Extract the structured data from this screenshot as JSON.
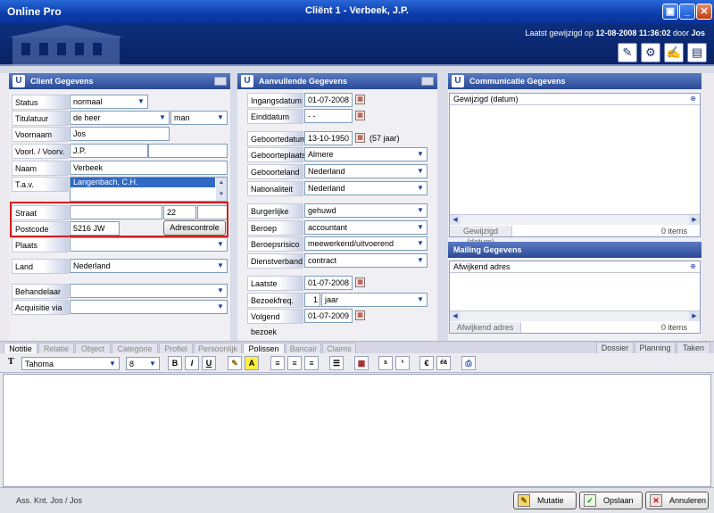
{
  "window": {
    "app_title": "Online Pro",
    "title": "Cliënt 1  -  Verbeek, J.P."
  },
  "header": {
    "last_modified_prefix": "Laatst gewijzigd op ",
    "last_modified_date": "12-08-2008 11:36:02",
    "by_label": " door ",
    "user": "Jos"
  },
  "client": {
    "title": "Client Gegevens",
    "status_label": "Status",
    "status": "normaal",
    "titulatuur_label": "Titulatuur",
    "titulatuur": "de heer",
    "gender": "man",
    "voornaam_label": "Voornaam",
    "voornaam": "Jos",
    "voorl_label": "Voorl. / Voorv.",
    "voorletters": "J.P.",
    "naam_label": "Naam",
    "naam": "Verbeek",
    "tav_label": "T.a.v.",
    "tav": "Langenbach, C.H.",
    "straat_label": "Straat",
    "huisnummer": "22",
    "postcode_label": "Postcode",
    "postcode": "5216 JW",
    "adrescontrole": "Adrescontrole",
    "plaats_label": "Plaats",
    "land_label": "Land",
    "land": "Nederland",
    "behandelaar_label": "Behandelaar",
    "acquisitie_label": "Acquisitie via"
  },
  "extra": {
    "title": "Aanvullende Gegevens",
    "ingangsdatum_label": "Ingangsdatum",
    "ingangsdatum": "01-07-2008",
    "einddatum_label": "Einddatum",
    "einddatum": " -  -",
    "geboortedatum_label": "Geboortedatum",
    "geboortedatum": "13-10-1950",
    "leeftijd": "(57 jaar)",
    "geboorteplaats_label": "Geboorteplaats",
    "geboorteplaats": "Almere",
    "geboorteland_label": "Geboorteland",
    "geboorteland": "Nederland",
    "nationaliteit_label": "Nationaliteit",
    "nationaliteit": "Nederland",
    "burgerlijke_label": "Burgerlijke staat",
    "burgerlijke": "gehuwd",
    "beroep_label": "Beroep",
    "beroep": "accountant",
    "beroepsrisico_label": "Beroepsrisico",
    "beroepsrisico": "meewerkend/uitvoerend",
    "dienstverband_label": "Dienstverband",
    "dienstverband": "contract",
    "laatste_label": "Laatste bezoek",
    "laatste": "01-07-2008",
    "bezoekfreq_label": "Bezoekfreq.",
    "bezoekfreq_num": "1",
    "bezoekfreq_unit": "jaar",
    "volgend_label": "Volgend bezoek",
    "volgend": "01-07-2009"
  },
  "comm": {
    "title": "Communicatie Gegevens",
    "list_header": "Gewijzigd (datum)",
    "footer_col": "Gewijzigd (datum)",
    "footer_count": "0 items",
    "mailing_title": "Mailing Gegevens",
    "mailing_header": "Afwijkend adres",
    "mailing_footer_col": "Afwijkend adres",
    "mailing_count": "0 items"
  },
  "tabs": [
    "Notitie",
    "Relatie",
    "Object",
    "Categorie",
    "Profiel",
    "Persoonlijk",
    "Polissen",
    "Bancair",
    "Claims"
  ],
  "right_tabs": [
    "Dossier",
    "Planning",
    "Taken"
  ],
  "toolbar": {
    "font": "Tahoma",
    "size": "8",
    "bold": "B",
    "italic": "I",
    "underline": "U"
  },
  "status": {
    "text": "Ass. Knt. Jos / Jos"
  },
  "buttons": {
    "mutatie": "Mutatie",
    "opslaan": "Opslaan",
    "annuleren": "Annuleren"
  },
  "colors": {
    "accent": "#0b3dab",
    "highlight": "#d41f1f"
  }
}
